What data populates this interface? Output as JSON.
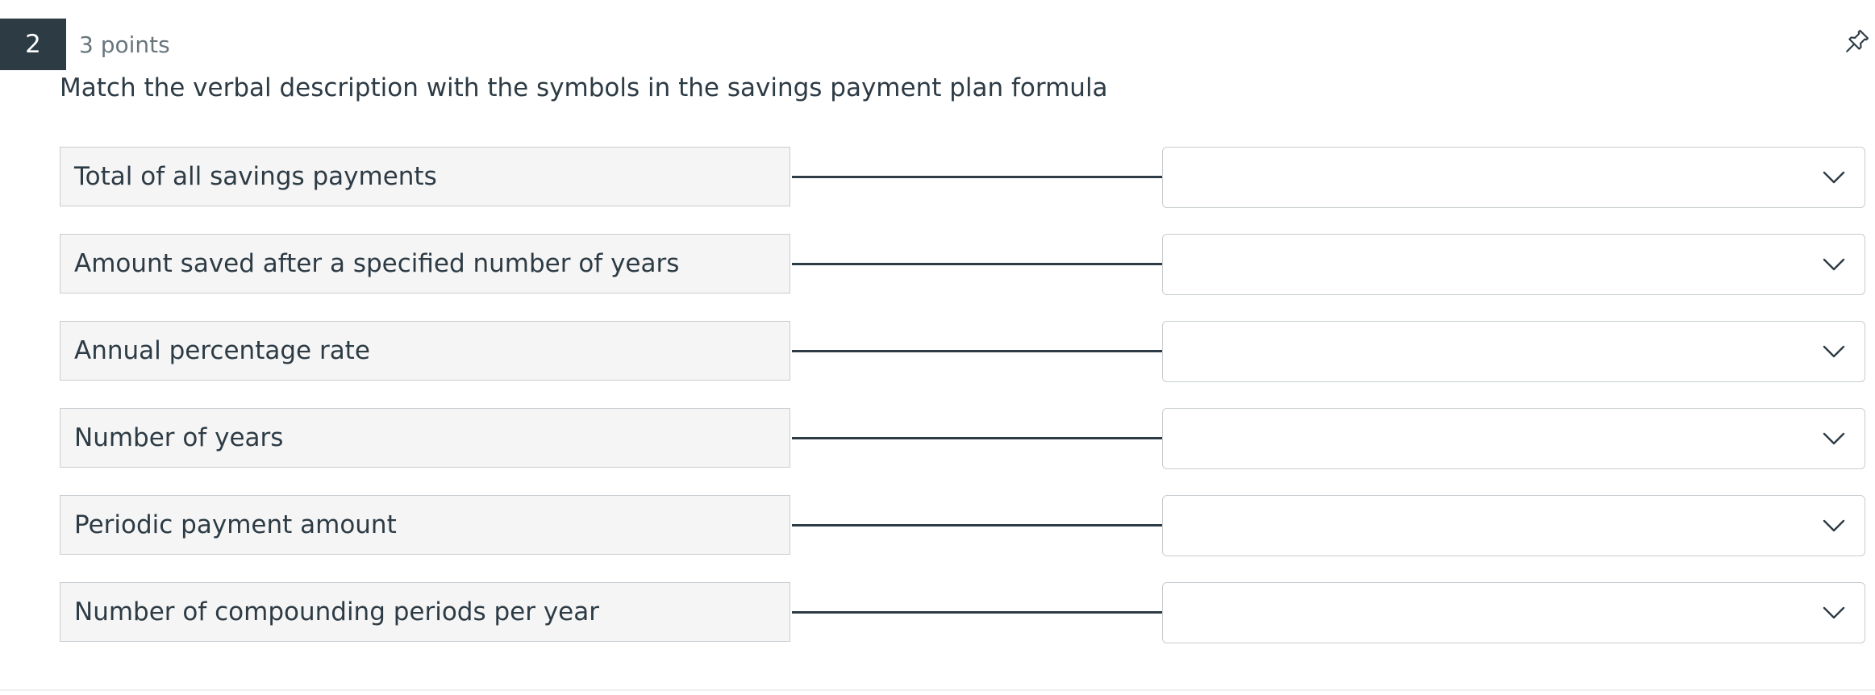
{
  "question": {
    "number": "2",
    "points": "3 points",
    "text": "Match the verbal description with the symbols in the savings payment plan formula",
    "pin_icon": "pushpin-icon"
  },
  "rows": [
    {
      "prompt": "Total of all savings payments",
      "selected": ""
    },
    {
      "prompt": "Amount saved after a specified number of years",
      "selected": ""
    },
    {
      "prompt": "Annual percentage rate",
      "selected": ""
    },
    {
      "prompt": "Number of years",
      "selected": ""
    },
    {
      "prompt": "Periodic payment amount",
      "selected": ""
    },
    {
      "prompt": "Number of compounding periods per year",
      "selected": ""
    }
  ],
  "colors": {
    "dark": "#2d3b45",
    "muted": "#68777d",
    "prompt_bg": "#f5f5f5",
    "border": "#c7cdd1"
  }
}
